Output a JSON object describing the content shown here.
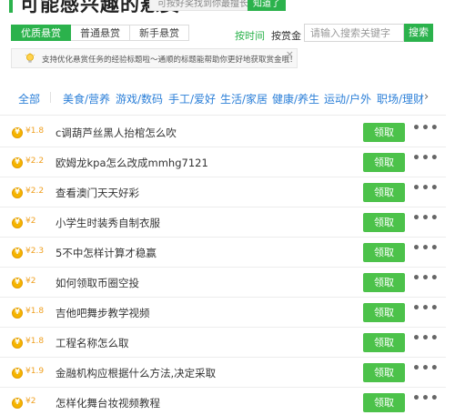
{
  "header": {
    "title": "可能感兴趣的悬赏",
    "hint": "可按好奖找到你最擅长的悬赏",
    "hint_button": "知道了"
  },
  "tabs": [
    {
      "label": "优质悬赏",
      "active": true
    },
    {
      "label": "普通悬赏",
      "active": false
    },
    {
      "label": "新手悬赏",
      "active": false
    }
  ],
  "sort": {
    "by_time": "按时间",
    "by_bounty": "按赏金"
  },
  "search": {
    "placeholder": "请输入搜索关键字",
    "button": "搜索"
  },
  "tip": {
    "icon": "lightbulb-icon",
    "text": "支持优化悬赏任务的经验标题啦～通顺的标题能帮助你更好地获取赏金哦！",
    "close": "×"
  },
  "categories": [
    "全部",
    "美食/营养",
    "游戏/数码",
    "手工/爱好",
    "生活/家居",
    "健康/养生",
    "运动/户外",
    "职场/理财"
  ],
  "category_next": "›",
  "rows": [
    {
      "amount": "¥1.8",
      "title": "c调葫芦丝黑人抬棺怎么吹"
    },
    {
      "amount": "¥2.2",
      "title": "欧姆龙kpa怎么改成mmhg7121"
    },
    {
      "amount": "¥2.2",
      "title": "查看澳门天天好彩"
    },
    {
      "amount": "¥2",
      "title": "小学生时装秀自制衣服"
    },
    {
      "amount": "¥2.3",
      "title": "5不中怎样计算才稳赢"
    },
    {
      "amount": "¥2",
      "title": "如何领取币圈空投"
    },
    {
      "amount": "¥1.8",
      "title": "吉他吧舞步教学视频"
    },
    {
      "amount": "¥1.8",
      "title": "工程名称怎么取"
    },
    {
      "amount": "¥1.9",
      "title": "金融机构应根据什么方法,决定采取"
    },
    {
      "amount": "¥2",
      "title": "怎样化舞台妆视频教程"
    }
  ],
  "row_actions": {
    "claim": "领取",
    "more": "•••"
  },
  "colors": {
    "brand_green": "#2bb24c",
    "claim_green": "#4cc24a",
    "category_blue": "#2b7fd8",
    "coin_gold": "#f5b400"
  }
}
